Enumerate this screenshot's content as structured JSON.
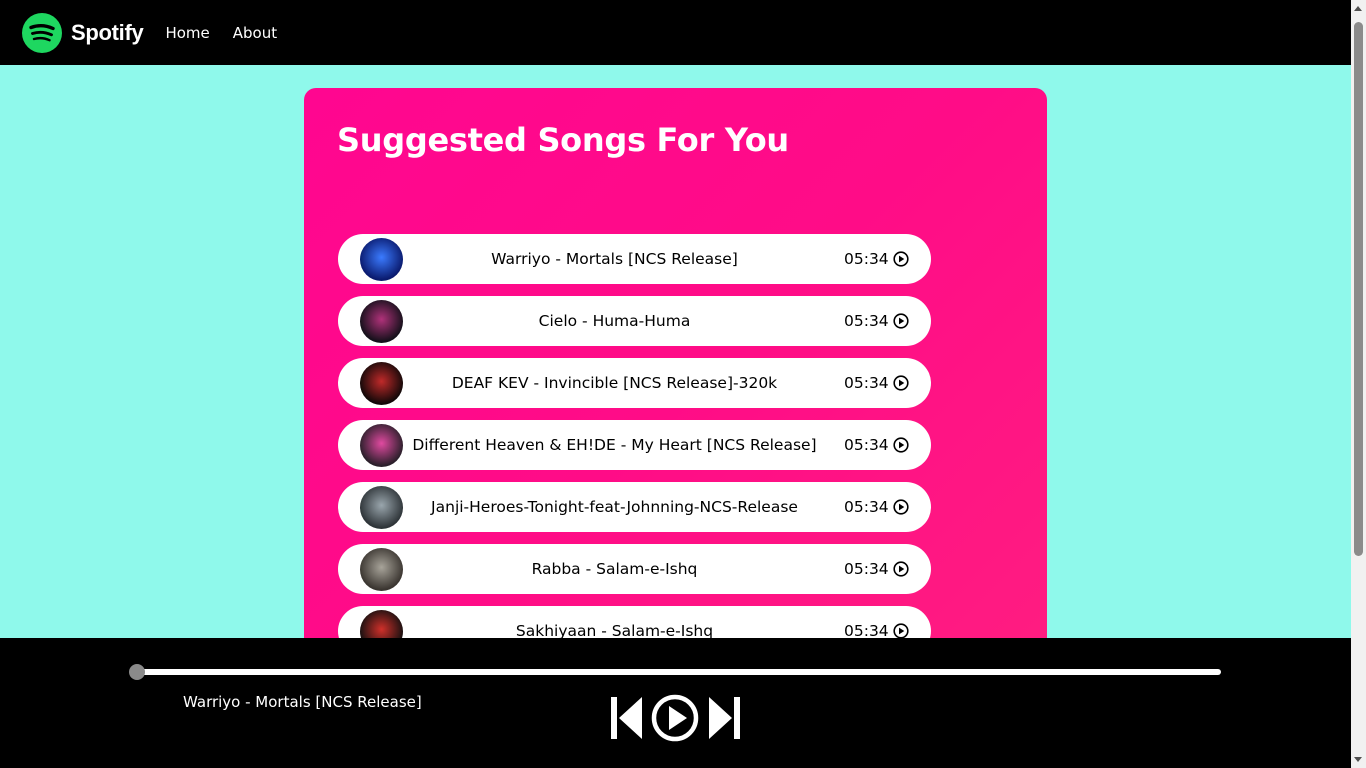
{
  "nav": {
    "logo_text": "Spotify",
    "links": [
      "Home",
      "About"
    ]
  },
  "panel": {
    "title": "Suggested Songs For You"
  },
  "songs": [
    {
      "name": "Warriyo - Mortals [NCS Release]",
      "duration": "05:34",
      "cover_colors": [
        "#0a1a6e",
        "#3b7bff"
      ]
    },
    {
      "name": "Cielo - Huma-Huma",
      "duration": "05:34",
      "cover_colors": [
        "#14101a",
        "#b0327a"
      ]
    },
    {
      "name": "DEAF KEV - Invincible [NCS Release]-320k",
      "duration": "05:34",
      "cover_colors": [
        "#120808",
        "#c02a2a"
      ]
    },
    {
      "name": "Different Heaven & EH!DE - My Heart [NCS Release]",
      "duration": "05:34",
      "cover_colors": [
        "#2a1f2a",
        "#e04aa0"
      ]
    },
    {
      "name": "Janji-Heroes-Tonight-feat-Johnning-NCS-Release",
      "duration": "05:34",
      "cover_colors": [
        "#2e3438",
        "#9aa6ad"
      ]
    },
    {
      "name": "Rabba - Salam-e-Ishq",
      "duration": "05:34",
      "cover_colors": [
        "#3a3530",
        "#a8a49a"
      ]
    },
    {
      "name": "Sakhiyaan - Salam-e-Ishq",
      "duration": "05:34",
      "cover_colors": [
        "#151010",
        "#d0302a"
      ]
    }
  ],
  "player": {
    "now_playing": "Warriyo - Mortals [NCS Release]",
    "progress": 0
  },
  "colors": {
    "page_bg": "#8ff9eb",
    "panel_accent": "#ff0690",
    "brand_green": "#1ed760"
  },
  "icons": [
    "spotify-logo-icon",
    "play-circle-icon",
    "previous-track-icon",
    "play-button-icon",
    "next-track-icon"
  ]
}
